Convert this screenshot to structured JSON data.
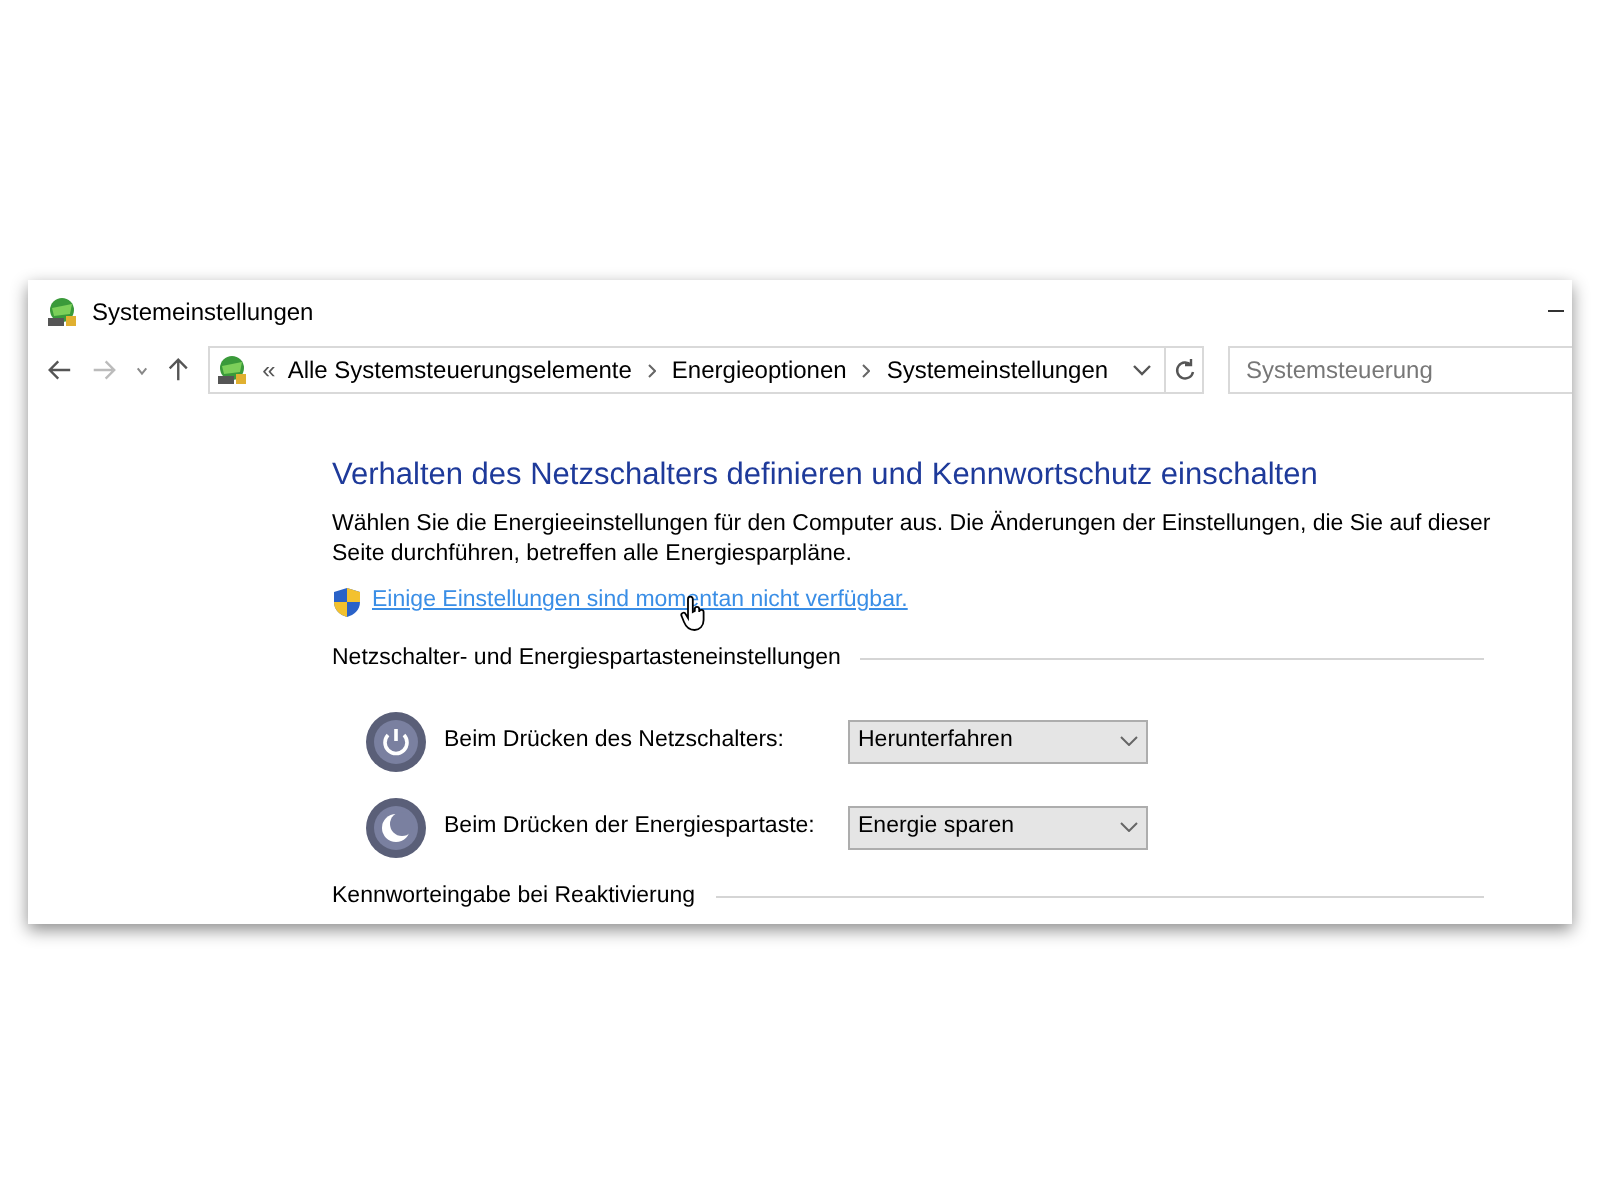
{
  "window": {
    "title": "Systemeinstellungen"
  },
  "address_bar": {
    "overflow_marker": "«",
    "breadcrumbs": [
      "Alle Systemsteuerungselemente",
      "Energieoptionen",
      "Systemeinstellungen"
    ]
  },
  "search": {
    "placeholder": "Systemsteuerung"
  },
  "heading": "Verhalten des Netzschalters definieren und Kennwortschutz einschalten",
  "description": "Wählen Sie die Energieeinstellungen für den Computer aus. Die Änderungen der Einstellungen, die Sie auf dieser Seite durchführen, betreffen alle Energiesparpläne.",
  "admin_link": "Einige Einstellungen sind momentan nicht verfügbar.",
  "sections": [
    {
      "title": "Netzschalter- und Energiespartasteneinstellungen",
      "settings": [
        {
          "kind": "power",
          "label": "Beim Drücken des Netzschalters:",
          "value": "Herunterfahren"
        },
        {
          "kind": "sleep",
          "label": "Beim Drücken der Energiespartaste:",
          "value": "Energie sparen"
        }
      ]
    },
    {
      "title": "Kennworteingabe bei Reaktivierung"
    }
  ]
}
